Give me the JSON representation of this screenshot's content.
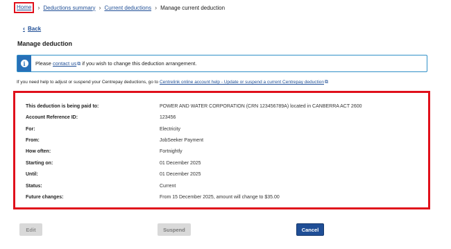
{
  "breadcrumb": {
    "home": "Home",
    "deductions_summary": "Deductions summary",
    "current_deductions": "Current deductions",
    "current_page": "Manage current deduction"
  },
  "back_label": "Back",
  "page_title": "Manage deduction",
  "info": {
    "prefix": "Please ",
    "link": "contact us",
    "suffix": " if you wish to change this deduction arrangement."
  },
  "help": {
    "prefix": "If you need help to adjust or suspend your Centrepay deductions, go to ",
    "link": "Centrelink online account help - Update or suspend a current Centrepay deduction"
  },
  "details": [
    {
      "label": "This deduction is being paid to:",
      "value": "POWER AND WATER CORPORATION (CRN 123456789A) located in CANBERRA ACT 2600"
    },
    {
      "label": "Account Reference ID:",
      "value": "123456"
    },
    {
      "label": "For:",
      "value": "Electricity"
    },
    {
      "label": "From:",
      "value": "JobSeeker Payment"
    },
    {
      "label": "How often:",
      "value": "Fortnightly"
    },
    {
      "label": "Starting on:",
      "value": "01 December 2025"
    },
    {
      "label": "Until:",
      "value": "01 December 2025"
    },
    {
      "label": "Status:",
      "value": "Current"
    },
    {
      "label": "Future changes:",
      "value": "From 15 December 2025, amount will change to $35.00"
    }
  ],
  "buttons": {
    "edit": "Edit",
    "suspend": "Suspend",
    "cancel": "Cancel"
  },
  "colors": {
    "link": "#1f4e96",
    "highlight": "#e0101b",
    "info_accent": "#2770b8",
    "primary_button": "#1f4e96",
    "disabled_button": "#d9d9d9"
  },
  "icons": {
    "info": "info-icon",
    "external_link": "external-link-icon",
    "back": "chevron-left-icon",
    "breadcrumb_separator": "chevron-right-icon"
  }
}
